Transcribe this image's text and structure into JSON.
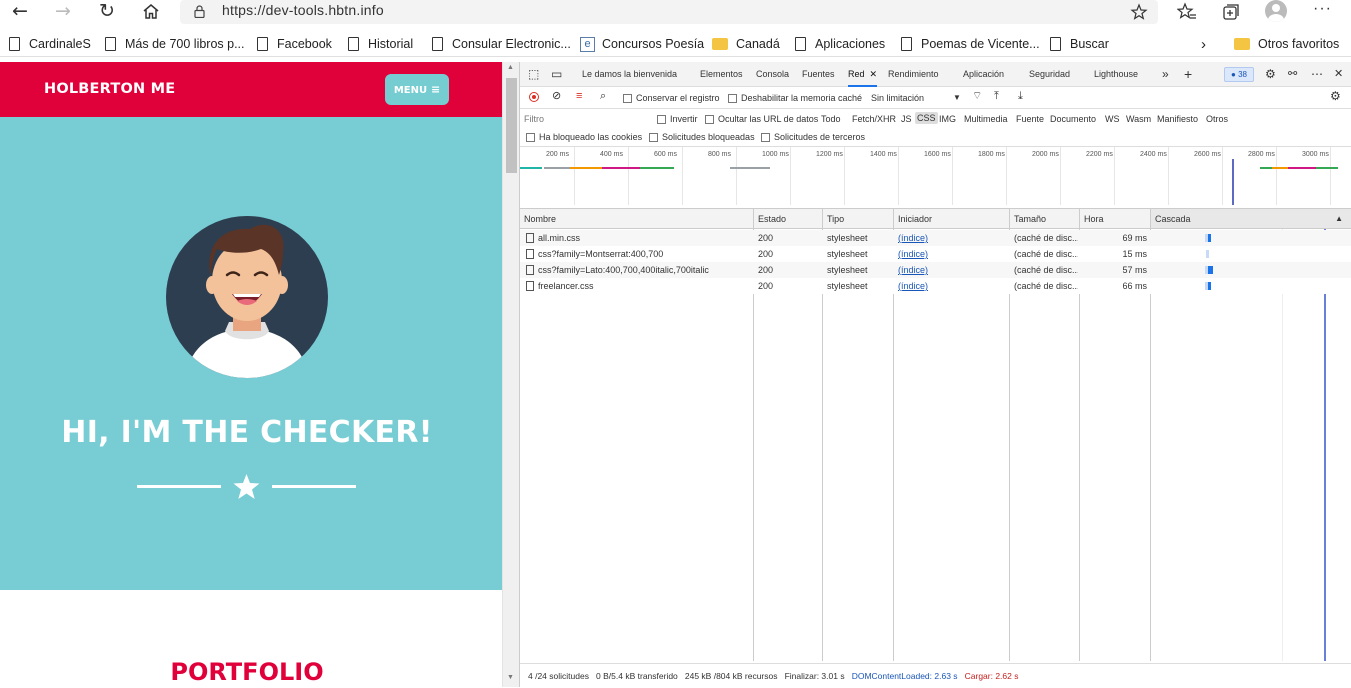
{
  "browser": {
    "url": "https://dev-tools.hbtn.info",
    "bookmarks": [
      "CardinaleS",
      "Más de 700 libros p...",
      "Facebook",
      "Historial",
      "Consular Electronic...",
      "Concursos Poesía",
      "Canadá",
      "Aplicaciones",
      "Poemas de Vicente...",
      "Buscar"
    ],
    "other_favorites": "Otros favoritos"
  },
  "page": {
    "brand": "HOLBERTON ME",
    "menu_label": "MENU",
    "hero_title": "HI, I'M THE CHECKER!",
    "portfolio_heading": "PORTFOLIO",
    "colors": {
      "navbar": "#e0003a",
      "hero": "#78ccd3",
      "menu_button": "#75ccd1"
    }
  },
  "devtools": {
    "tabs": [
      "Le damos la bienvenida",
      "Elementos",
      "Consola",
      "Fuentes",
      "Red",
      "Rendimiento",
      "Aplicación",
      "Seguridad",
      "Lighthouse"
    ],
    "active_tab": "Red",
    "issues_count": "38",
    "toolbar": {
      "preserve_log": "Conservar el registro",
      "disable_cache": "Deshabilitar la memoria caché",
      "throttle": "Sin limitación"
    },
    "filter": {
      "placeholder": "Filtro",
      "invert": "Invertir",
      "hide_data_urls": "Ocultar las URL de datos",
      "types": [
        "Todo",
        "Fetch/XHR",
        "JS",
        "CSS",
        "IMG",
        "Multimedia",
        "Fuente",
        "Documento",
        "WS",
        "Wasm",
        "Manifiesto",
        "Otros"
      ],
      "active_type": "CSS",
      "blocked_cookies": "Ha bloqueado las cookies",
      "blocked_requests": "Solicitudes bloqueadas",
      "third_party": "Solicitudes de terceros"
    },
    "overview_ticks": [
      "200 ms",
      "400 ms",
      "600 ms",
      "800 ms",
      "1000 ms",
      "1200 ms",
      "1400 ms",
      "1600 ms",
      "1800 ms",
      "2000 ms",
      "2200 ms",
      "2400 ms",
      "2600 ms",
      "2800 ms",
      "3000 ms"
    ],
    "columns": [
      "Nombre",
      "Estado",
      "Tipo",
      "Iniciador",
      "Tamaño",
      "Hora",
      "Cascada"
    ],
    "rows": [
      {
        "name": "all.min.css",
        "status": "200",
        "type": "stylesheet",
        "initiator": "(índice)",
        "size": "(caché de disc...",
        "time": "69 ms"
      },
      {
        "name": "css?family=Montserrat:400,700",
        "status": "200",
        "type": "stylesheet",
        "initiator": "(índice)",
        "size": "(caché de disc...",
        "time": "15 ms"
      },
      {
        "name": "css?family=Lato:400,700,400italic,700italic",
        "status": "200",
        "type": "stylesheet",
        "initiator": "(índice)",
        "size": "(caché de disc...",
        "time": "57 ms"
      },
      {
        "name": "freelancer.css",
        "status": "200",
        "type": "stylesheet",
        "initiator": "(índice)",
        "size": "(caché de disc...",
        "time": "66 ms"
      }
    ],
    "summary": {
      "requests": "4 /24 solicitudes",
      "transferred": "0 B/5.4 kB transferido",
      "resources": "245 kB /804 kB recursos",
      "finish": "Finalizar: 3.01 s",
      "dom_content_loaded": "DOMContentLoaded: 2.63 s",
      "load": "Cargar: 2.62 s"
    }
  }
}
